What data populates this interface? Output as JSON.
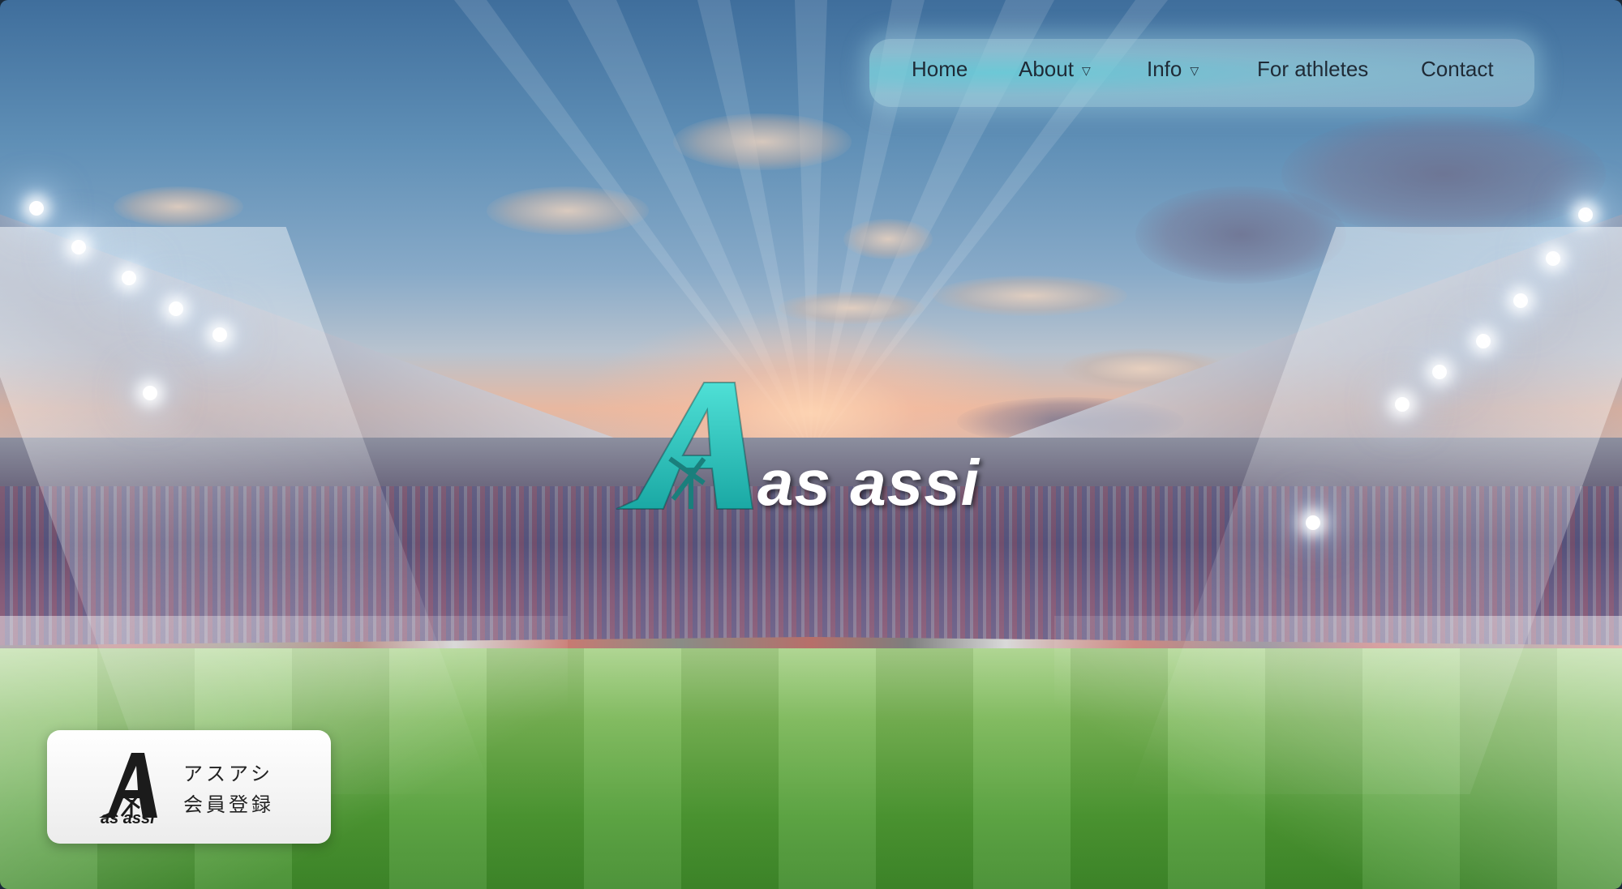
{
  "nav": {
    "items": [
      {
        "label": "Home",
        "has_dropdown": false
      },
      {
        "label": "About",
        "has_dropdown": true
      },
      {
        "label": "Info",
        "has_dropdown": true
      },
      {
        "label": "For athletes",
        "has_dropdown": false
      },
      {
        "label": "Contact",
        "has_dropdown": false
      }
    ],
    "dropdown_icon": "triangle-down-icon",
    "accent_color": "#6fd3dc"
  },
  "hero": {
    "logo_text": "as assi",
    "logo_mark_color": "#2fc8c0",
    "background": "stadium-at-sunset"
  },
  "member_card": {
    "logo_text": "as assi",
    "line1": "アスアシ",
    "line2": "会員登録"
  }
}
